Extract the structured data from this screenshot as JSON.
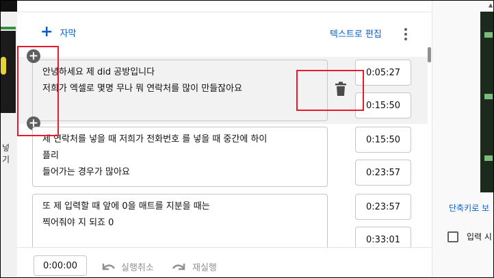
{
  "toolbar": {
    "add_subtitle_label": "자막",
    "edit_as_text_label": "텍스트로 편집"
  },
  "captions": [
    {
      "text_lines": [
        "안녕하세요 제 did 공방입니다",
        "저희가 엑셀로 몇명 무나 뭐 연락처를 많이 만들잖아요"
      ],
      "start": "0:05:27",
      "end": "0:15:50"
    },
    {
      "text_lines": [
        "제 연락처를 넣을 때 저희가 전화번호 를 넣을 때 중간에 하이",
        "플리",
        "들어가는 경우가 많아요"
      ],
      "start": "0:15:50",
      "end": "0:23:57"
    },
    {
      "text_lines": [
        "또 제 입력할 때 앞에 0을 매트를 지분을 때는",
        "찍어줘야 지 되죠 0"
      ],
      "start": "0:23:57",
      "end": "0:33:01"
    }
  ],
  "footer": {
    "current_time": "0:00:00",
    "undo_label": "실행취소",
    "redo_label": "재실행"
  },
  "right_panel": {
    "shortcut_label": "단축키로 보",
    "checkbox_label": "입력 시"
  },
  "left_strip": {
    "text": "넣기"
  },
  "colors": {
    "accent": "#065fd4",
    "annotation": "#e8192c",
    "icon_gray": "#606060"
  }
}
